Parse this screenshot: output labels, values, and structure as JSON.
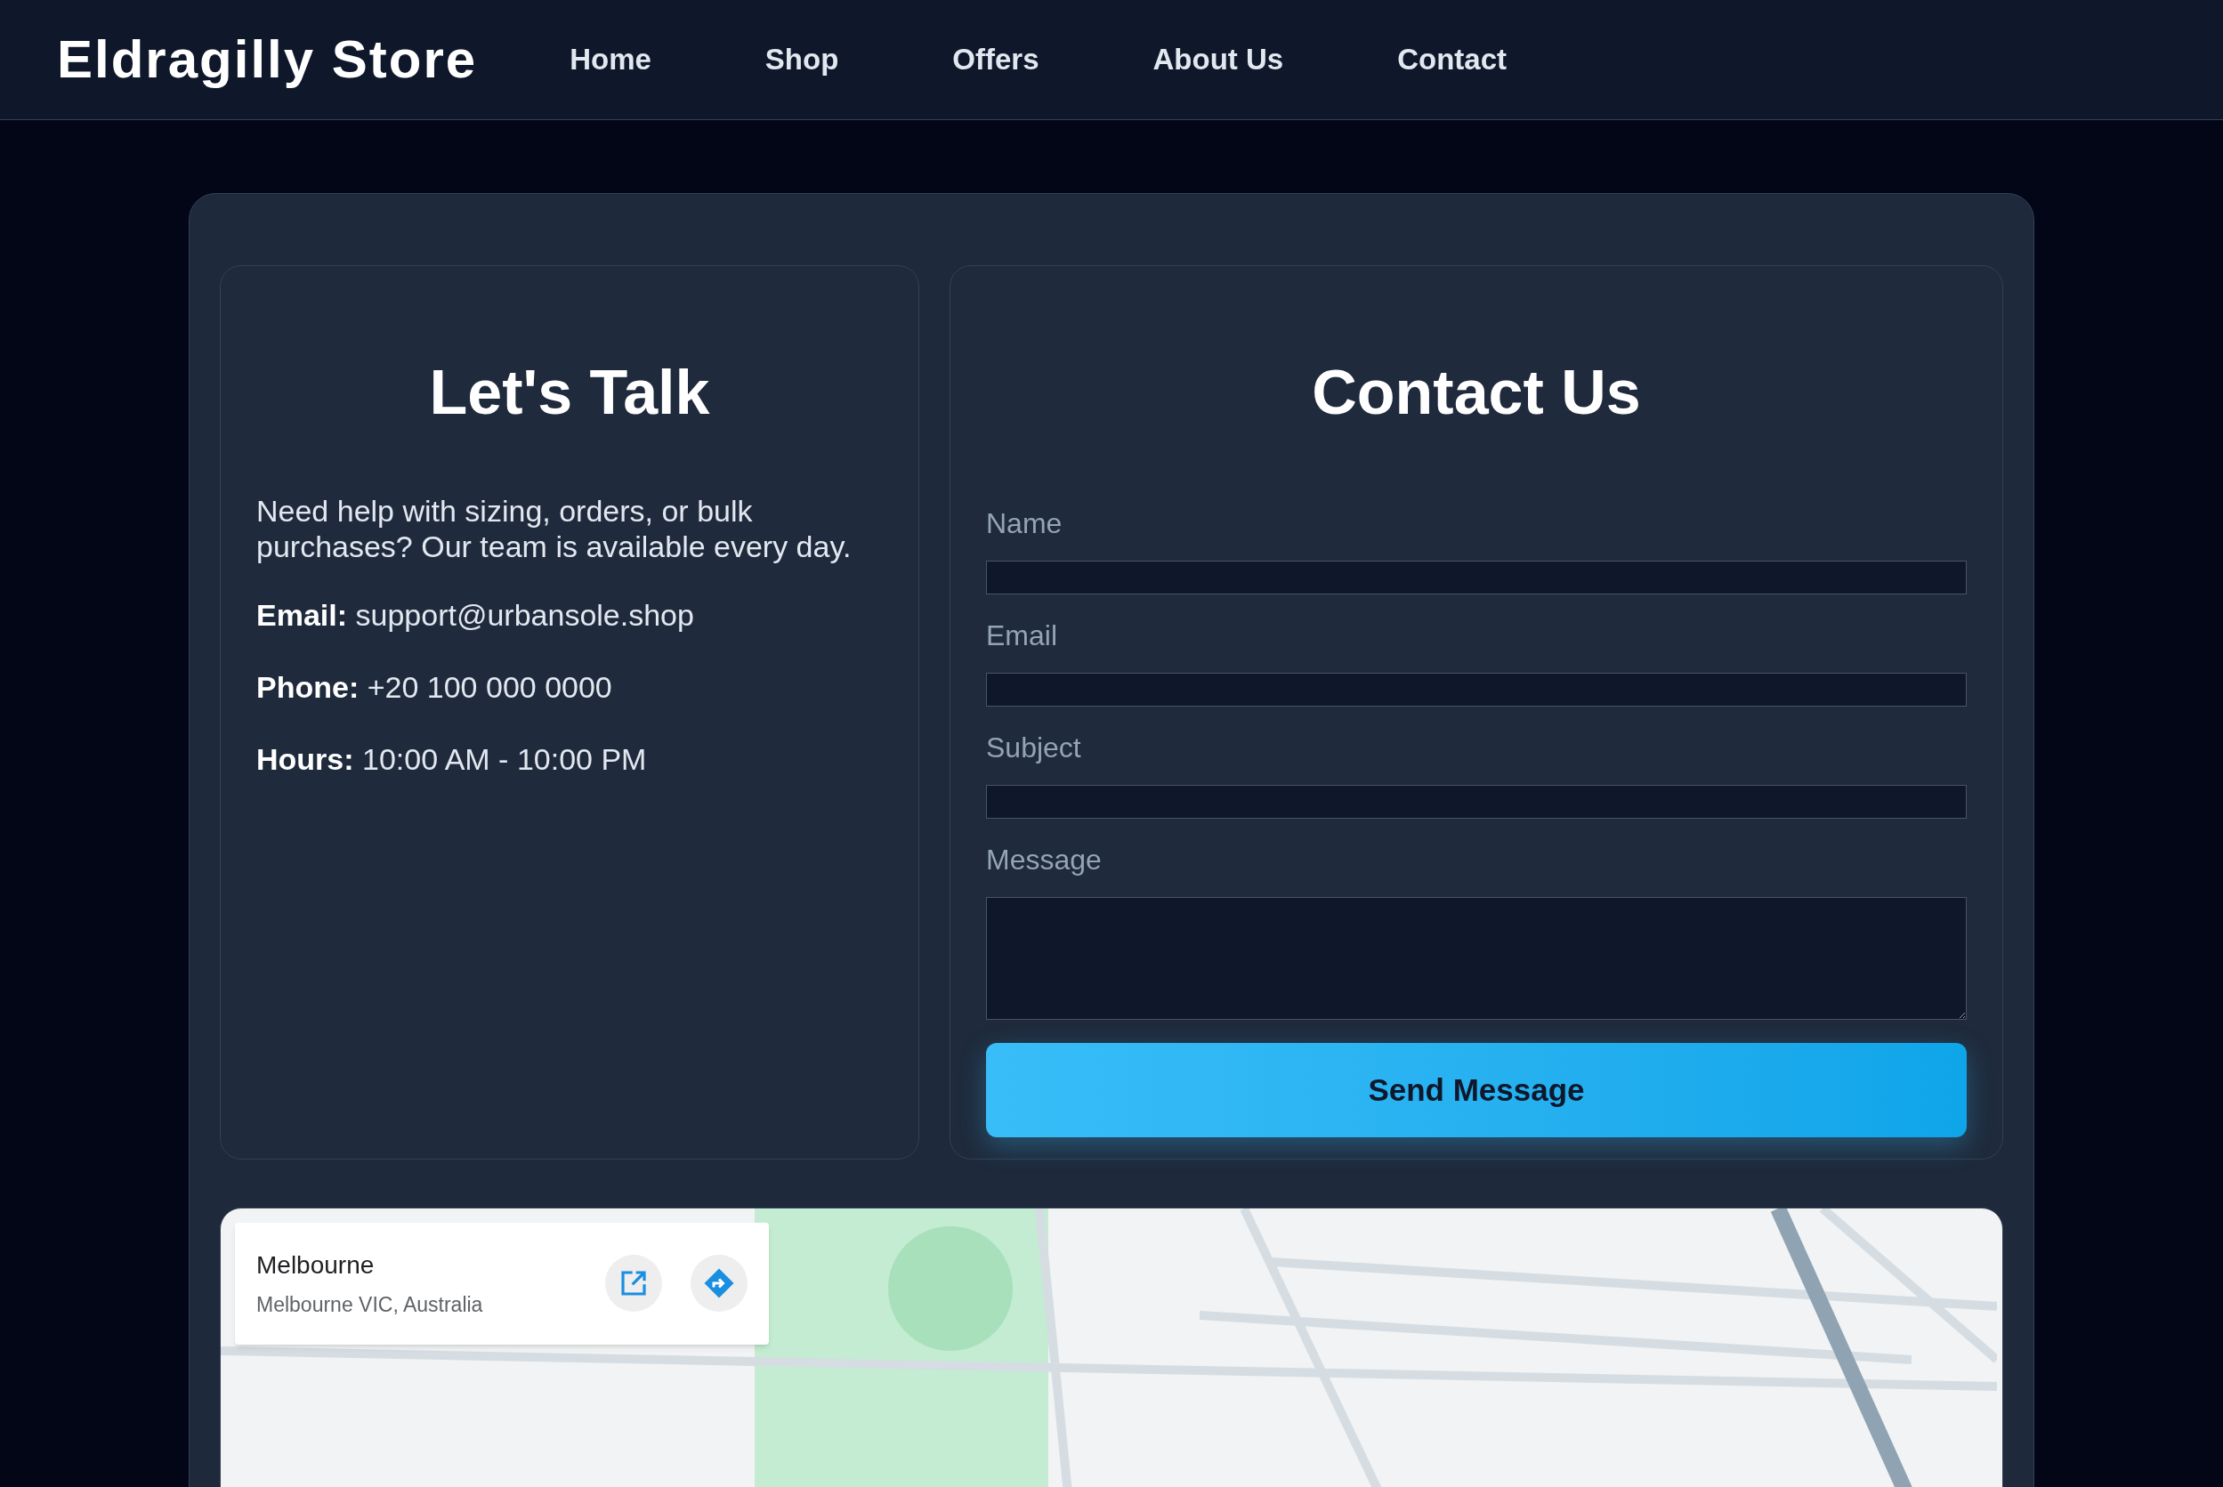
{
  "header": {
    "logo": "Eldragilly Store",
    "nav": [
      {
        "label": "Home"
      },
      {
        "label": "Shop"
      },
      {
        "label": "Offers"
      },
      {
        "label": "About Us"
      },
      {
        "label": "Contact"
      }
    ]
  },
  "info": {
    "title": "Let's Talk",
    "intro": "Need help with sizing, orders, or bulk purchases? Our team is available every day.",
    "lines": [
      {
        "label": "Email:",
        "value": "support@urbansole.shop"
      },
      {
        "label": "Phone:",
        "value": "+20 100 000 0000"
      },
      {
        "label": "Hours:",
        "value": "10:00 AM - 10:00 PM"
      }
    ]
  },
  "form": {
    "title": "Contact Us",
    "fields": [
      {
        "label": "Name",
        "kind": "input"
      },
      {
        "label": "Email",
        "kind": "input"
      },
      {
        "label": "Subject",
        "kind": "input"
      },
      {
        "label": "Message",
        "kind": "textarea"
      }
    ],
    "submit": "Send Message"
  },
  "map": {
    "place": "Melbourne",
    "address": "Melbourne VIC, Australia"
  }
}
